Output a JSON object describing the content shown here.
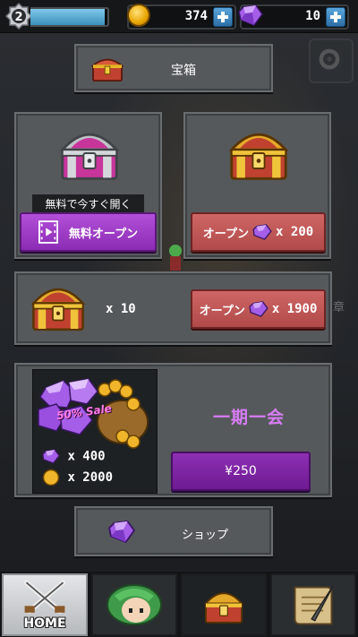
{
  "topbar": {
    "level": "2",
    "xp_progress": 0.96,
    "coins": "374",
    "gems": "10"
  },
  "title_panel": {
    "title": "宝箱"
  },
  "free_chest": {
    "label": "無料で今すぐ開く",
    "button_label": "無料オープン"
  },
  "paid_chest": {
    "button_label": "オープン",
    "price": "x 200"
  },
  "ten_chest": {
    "quantity": "x 10",
    "button_label": "オープン",
    "price": "x 1900"
  },
  "sale": {
    "tag": "50% Sale",
    "gems_amount": "x 400",
    "coins_amount": "x 2000",
    "title": "一期一会",
    "price_button": "¥250"
  },
  "shop": {
    "label": "ショップ"
  },
  "side_text": "章",
  "bottom_nav": {
    "home_label": "HOME"
  },
  "colors": {
    "accent_purple": "#8c2cb5",
    "accent_red": "#b14a4a",
    "gem": "#9b59e8",
    "sale_title": "#d77cf3"
  }
}
